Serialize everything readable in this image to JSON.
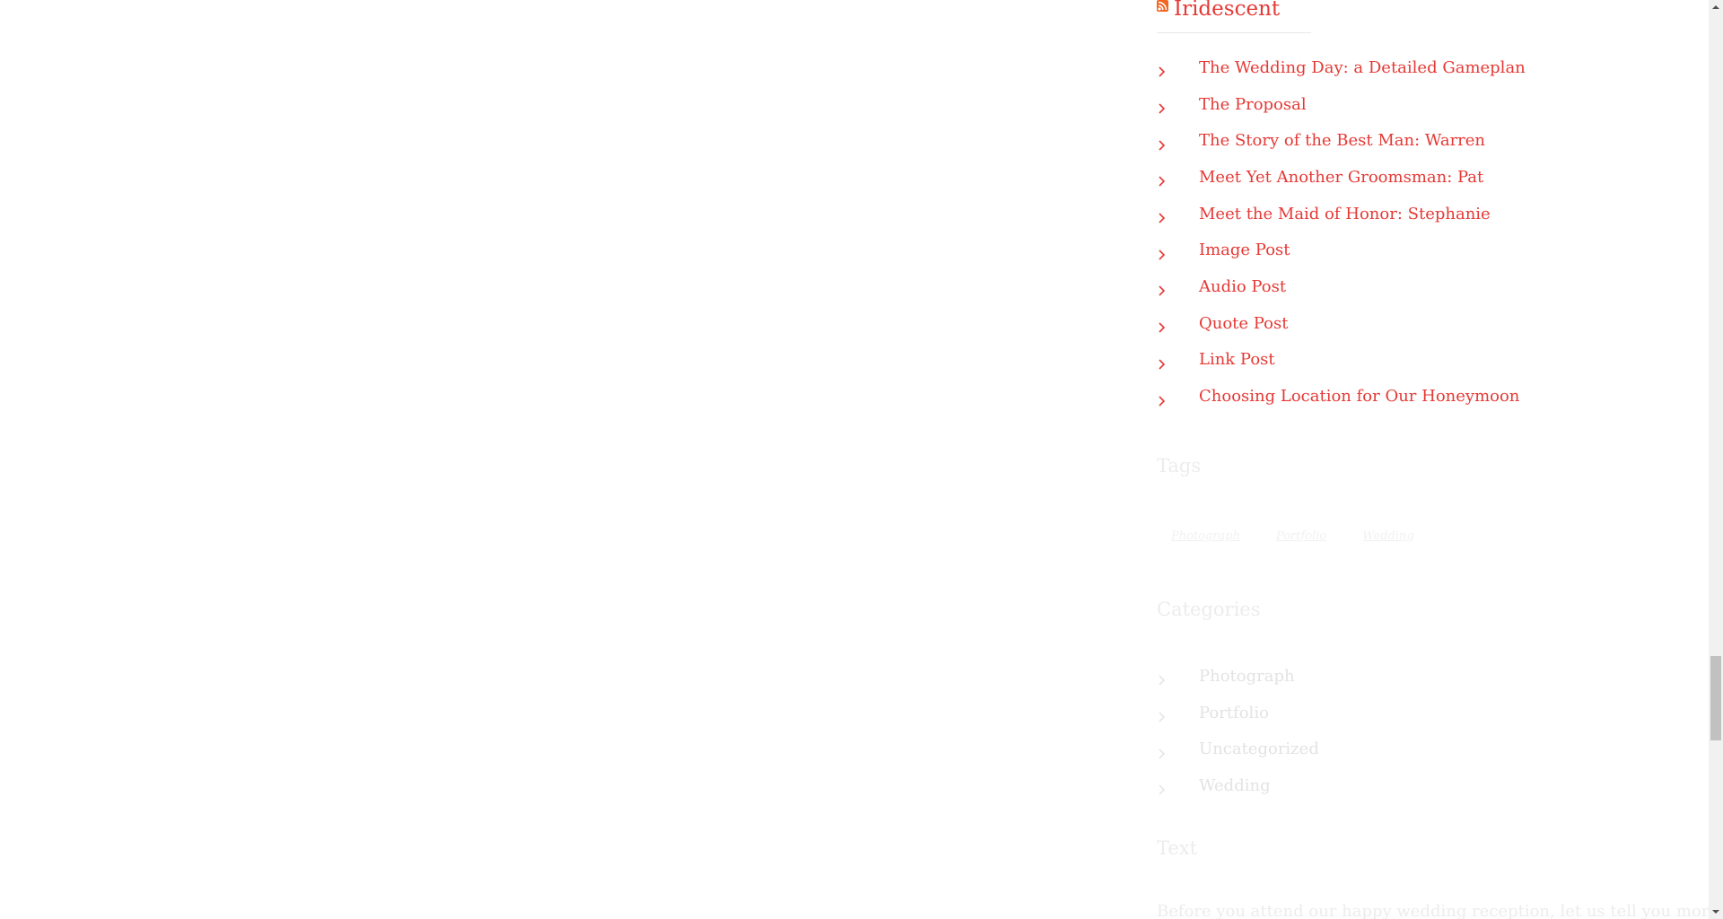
{
  "rss_widget": {
    "title": "Iridescent",
    "posts": [
      "The Wedding Day: a Detailed Gameplan",
      "The Proposal",
      "The Story of the Best Man: Warren",
      "Meet Yet Another Groomsman: Pat",
      "Meet the Maid of Honor: Stephanie",
      "Image Post",
      "Audio Post",
      "Quote Post",
      "Link Post",
      "Choosing Location for Our Honeymoon"
    ]
  },
  "tags_widget": {
    "heading": "Tags",
    "tags": [
      "Photograph",
      "Portfolio",
      "Wedding"
    ]
  },
  "categories_widget": {
    "heading": "Categories",
    "items": [
      "Photograph",
      "Portfolio",
      "Uncategorized",
      "Wedding"
    ]
  },
  "text_widget": {
    "heading": "Text",
    "body": "Before you attend our happy wedding reception, let us tell you more about the"
  },
  "colors": {
    "link": "#e53935",
    "rss_icon": "#f26522",
    "faded_text": "#ececec"
  },
  "icons": {
    "rss": "rss-icon",
    "list_bullet": "chevron-right-icon",
    "scroll_up": "chevron-up-icon",
    "scroll_down": "chevron-down-icon"
  }
}
